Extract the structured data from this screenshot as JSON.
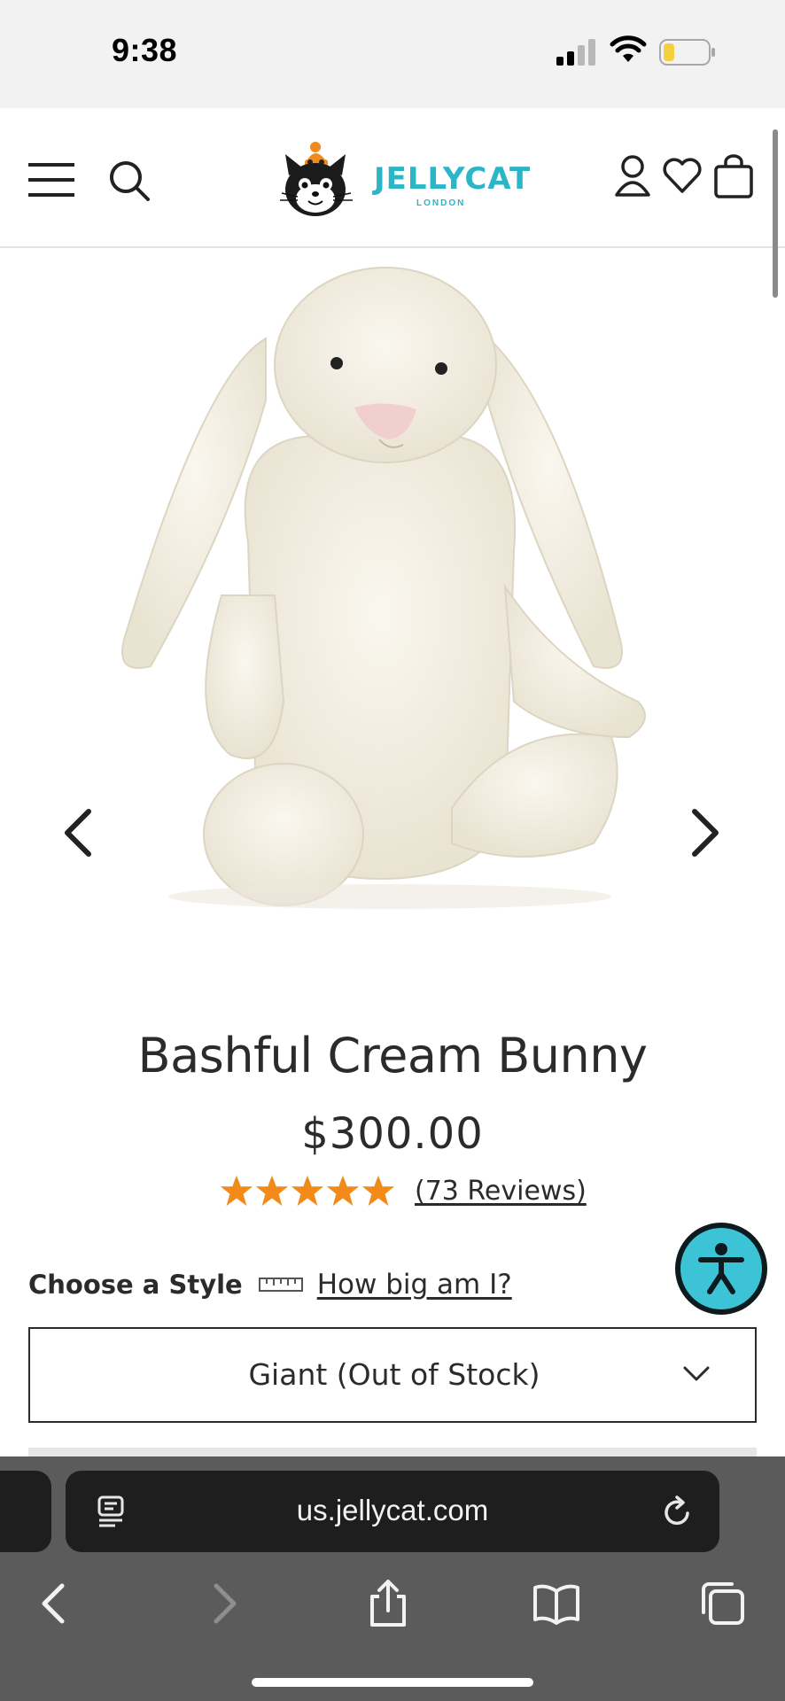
{
  "status_bar": {
    "time": "9:38"
  },
  "header": {
    "logo_text": "JELLYCAT",
    "logo_sub": "LONDON",
    "icons": [
      "menu-icon",
      "search-icon",
      "account-icon",
      "heart-icon",
      "bag-icon"
    ]
  },
  "product": {
    "title": "Bashful Cream Bunny",
    "price": "$300.00",
    "rating": 5,
    "reviews_label": "(73 Reviews)",
    "style_label": "Choose a Style",
    "size_link": "How big am I?",
    "selected_style": "Giant (Out of Stock)"
  },
  "browser": {
    "url": "us.jellycat.com"
  },
  "colors": {
    "brand_teal": "#2bb6c8",
    "star_orange": "#f28a1a",
    "accessibility": "#3cc3d6"
  }
}
